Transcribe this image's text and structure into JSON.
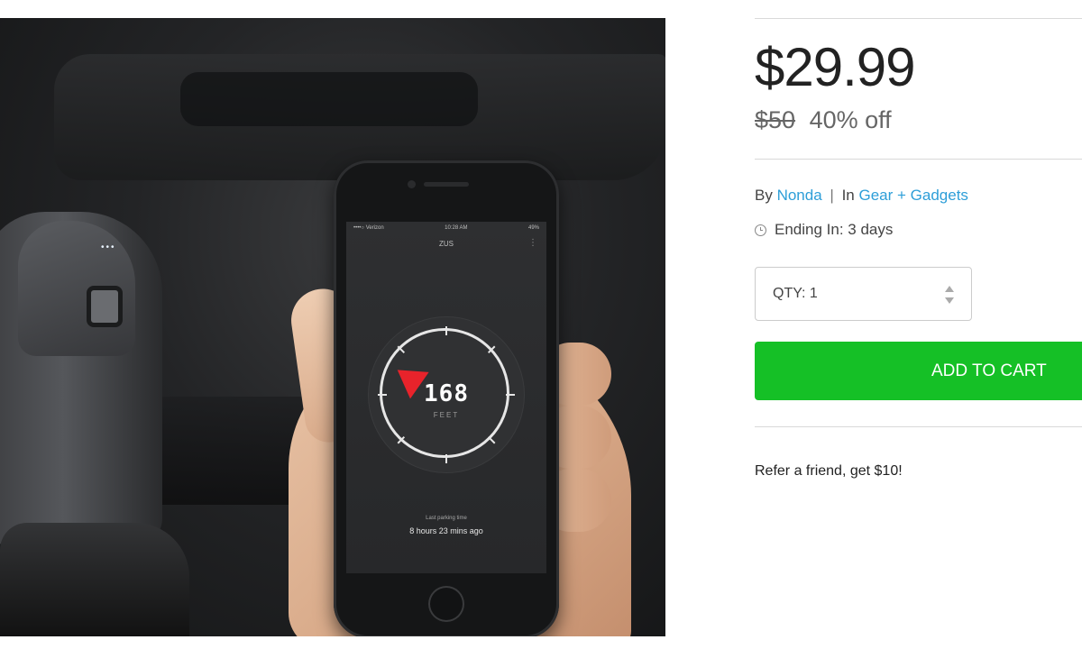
{
  "product": {
    "price": "$29.99",
    "original_price": "$50",
    "discount": "40% off",
    "by_label": "By",
    "vendor": "Nonda",
    "separator": "|",
    "in_label": "In",
    "category": "Gear + Gadgets",
    "ending": "Ending In: 3 days",
    "qty": "QTY: 1",
    "add_to_cart": "ADD TO CART",
    "refer": "Refer a friend, get $10!"
  },
  "phone_screen": {
    "carrier": "••••○ Verizon",
    "time": "10:28 AM",
    "battery": "49%",
    "app_name": "ZUS",
    "distance": "168",
    "unit": "FEET",
    "parking_label": "Last parking time",
    "parking_time": "8 hours 23 mins ago"
  },
  "colors": {
    "accent_green": "#15c026",
    "link_blue": "#2d9ed8",
    "pointer_red": "#e8232b"
  },
  "icons": {
    "ending": "clock-icon",
    "qty": "stepper-arrows-icon"
  }
}
